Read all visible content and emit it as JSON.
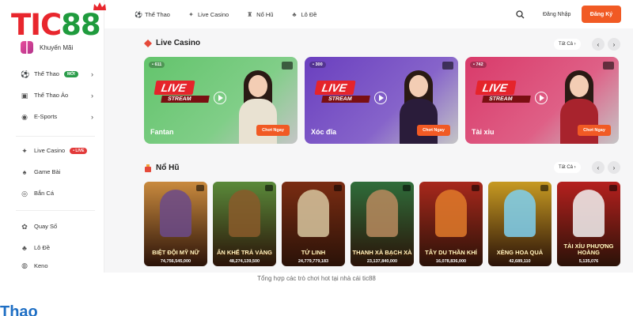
{
  "logo": {
    "part1": "TIC",
    "part2": "88"
  },
  "sidebar": {
    "promo_label": "Khuyến Mãi",
    "group1": [
      {
        "label": "Thể Thao",
        "icon": "soccer-icon",
        "badge": "MỚI",
        "chevron": "›"
      },
      {
        "label": "Thể Thao Ảo",
        "icon": "virtual-sport-icon",
        "chevron": "›"
      },
      {
        "label": "E-Sports",
        "icon": "esports-icon",
        "chevron": "›"
      }
    ],
    "group2": [
      {
        "label": "Live Casino",
        "icon": "live-casino-icon",
        "badge": "• LIVE"
      },
      {
        "label": "Game Bài",
        "icon": "cards-icon"
      },
      {
        "label": "Bắn Cá",
        "icon": "fish-icon"
      }
    ],
    "group3": [
      {
        "label": "Quay Số",
        "icon": "lottery-icon"
      },
      {
        "label": "Lô Đề",
        "icon": "lode-icon"
      },
      {
        "label": "Keno",
        "icon": "keno-icon"
      }
    ]
  },
  "topnav": {
    "items": [
      {
        "label": "Thể Thao",
        "icon": "soccer-icon"
      },
      {
        "label": "Live Casino",
        "icon": "live-casino-icon"
      },
      {
        "label": "Nổ Hũ",
        "icon": "slot-icon"
      },
      {
        "label": "Lô Đề",
        "icon": "lode-icon"
      }
    ],
    "login": "Đăng Nhập",
    "register": "Đăng Ký"
  },
  "live_casino": {
    "title": "Live Casino",
    "see_all": "Tất Cả  ›",
    "prev": "‹",
    "next": "›",
    "cards": [
      {
        "name": "Fantan",
        "players": "• 611",
        "live": "LIVE",
        "stream": "STREAM",
        "play": "Chơi Ngay",
        "bg": "#63c46c",
        "outfit": "#e9e2d2"
      },
      {
        "name": "Xóc đĩa",
        "players": "• 300",
        "live": "LIVE",
        "stream": "STREAM",
        "play": "Chơi Ngay",
        "bg": "#6a3fbf",
        "outfit": "#2a1c3a"
      },
      {
        "name": "Tài xỉu",
        "players": "• 742",
        "live": "LIVE",
        "stream": "STREAM",
        "play": "Chơi Ngay",
        "bg": "#d93a6a",
        "outfit": "#a8232d"
      }
    ]
  },
  "no_hu": {
    "title": "Nổ Hũ",
    "see_all": "Tất Cả  ›",
    "prev": "‹",
    "next": "›",
    "games": [
      {
        "name": "BIỆT ĐỘI MỸ NỮ",
        "jackpot": "74,756,545,000",
        "bg": "#c98a3e",
        "fig": "#6b4a8a"
      },
      {
        "name": "ẨN KHẾ TRẢ VÀNG",
        "jackpot": "48,274,139,500",
        "bg": "#5a8a3a",
        "fig": "#8a5a2a"
      },
      {
        "name": "TỨ LINH",
        "jackpot": "24,779,779,183",
        "bg": "#7a2c12",
        "fig": "#d8c7a0"
      },
      {
        "name": "THANH XÀ BẠCH XÀ",
        "jackpot": "23,137,840,000",
        "bg": "#2f6d3a",
        "fig": "#b98a5e"
      },
      {
        "name": "TÂY DU THẦN KHÍ",
        "jackpot": "16,078,836,000",
        "bg": "#a8281c",
        "fig": "#e07a2a"
      },
      {
        "name": "XÈNG HOA QUẢ",
        "jackpot": "42,689,110",
        "bg": "#c79a22",
        "fig": "#7fd0f0"
      },
      {
        "name": "TÀI XỈU PHƯỢNG HOÀNG",
        "jackpot": "5,135,076",
        "bg": "#b5201e",
        "fig": "#f2f2f2"
      }
    ]
  },
  "caption": "Tổng hợp các trò chơi hot tại nhà cái tic88",
  "bottom_heading": "Thao"
}
